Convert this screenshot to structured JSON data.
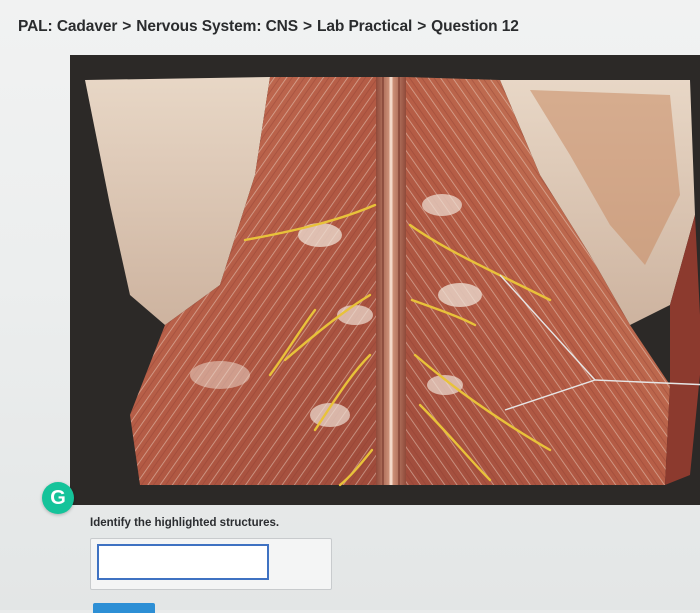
{
  "breadcrumb": {
    "items": [
      "PAL: Cadaver",
      "Nervous System: CNS",
      "Lab Practical",
      "Question 12"
    ],
    "separator": ">"
  },
  "image": {
    "subject": "dorsal view of spinal cord with highlighted spinal nerves",
    "highlight_color": "#e8c23a",
    "leader_line_color": "#e6e6e6"
  },
  "grammarly": {
    "letter": "G",
    "color": "#15c39a"
  },
  "question": {
    "prompt": "Identify the highlighted structures.",
    "answer_value": "",
    "answer_placeholder": ""
  },
  "colors": {
    "input_border": "#3f72c2",
    "submit_button": "#2d8fd5"
  }
}
